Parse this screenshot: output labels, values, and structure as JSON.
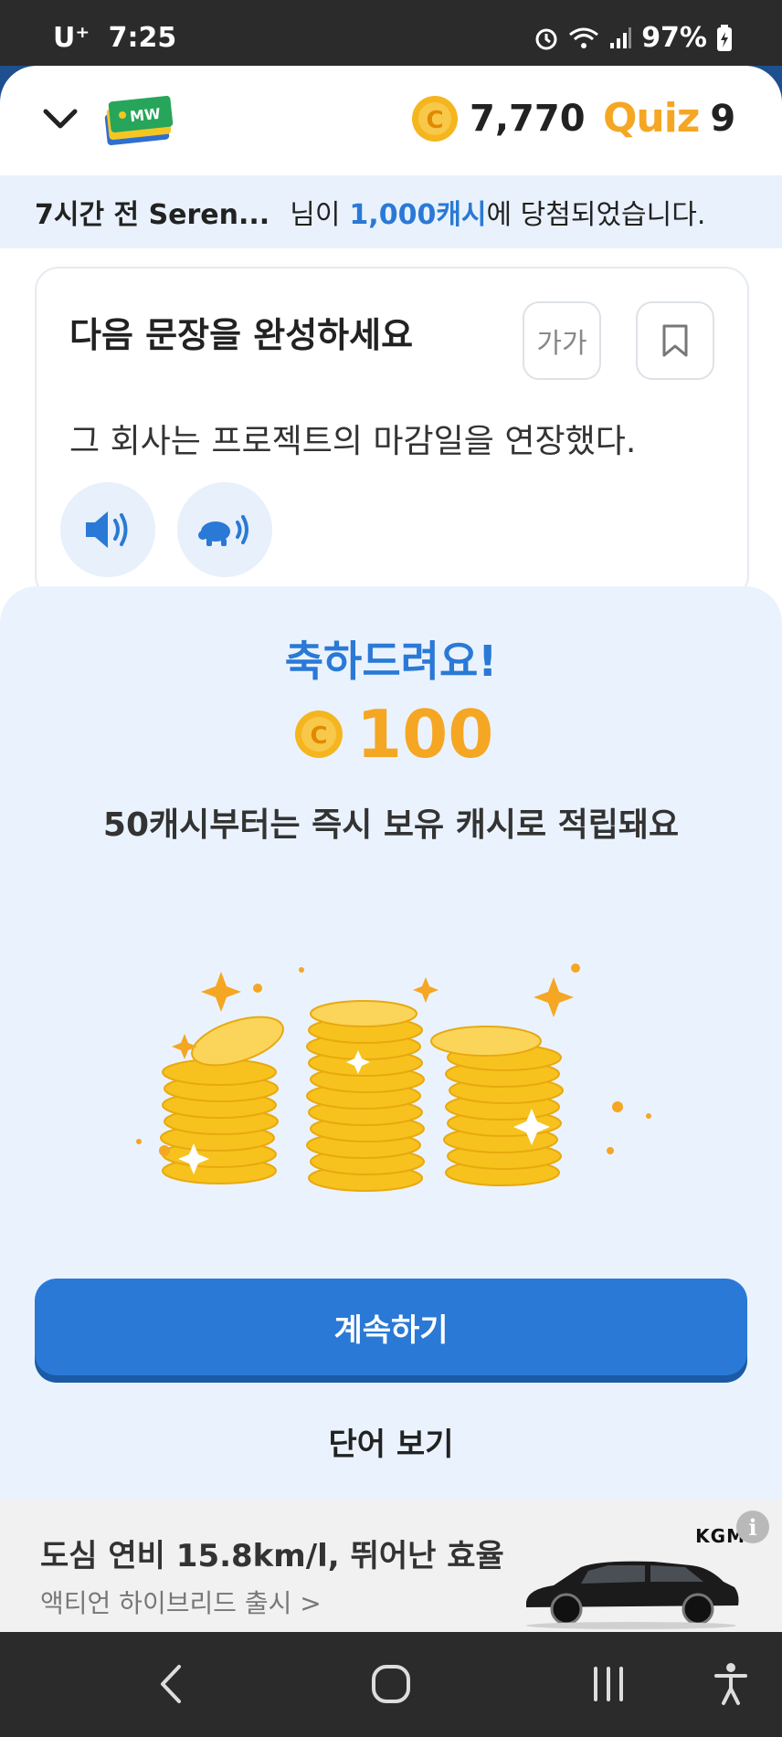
{
  "status": {
    "carrier": "U⁺",
    "time": "7:25",
    "battery": "97%"
  },
  "header": {
    "logo_text": "MW",
    "coins": "7,770",
    "quiz_label": "Quiz",
    "quiz_count": "9"
  },
  "ticker": {
    "time_user": "7시간 전 Seren...",
    "mid": "님이",
    "amount": "1,000캐시",
    "tail": "에 당첨되었습니다."
  },
  "card": {
    "title": "다음 문장을 완성하세요",
    "font_size_button": "가가",
    "sentence": "그 회사는 프로젝트의 마감일을 연장했다."
  },
  "modal": {
    "title": "축하드려요!",
    "reward": "100",
    "subtitle": "50캐시부터는 즉시 보유 캐시로 적립돼요",
    "continue_label": "계속하기",
    "view_words_label": "단어 보기"
  },
  "ad": {
    "headline": "도심 연비 15.8km/l, 뛰어난 효율",
    "sub": "액티언 하이브리드 출시 >",
    "brand": "KGM",
    "info": "i"
  },
  "colors": {
    "accent": "#2a79d6",
    "coin": "#f5a623",
    "modal_bg": "#eaf3fd"
  },
  "icons": [
    "chevron-down-icon",
    "coin-icon",
    "bookmark-icon",
    "speaker-icon",
    "slow-speaker-icon",
    "back-icon",
    "home-icon",
    "recents-icon",
    "accessibility-icon"
  ]
}
